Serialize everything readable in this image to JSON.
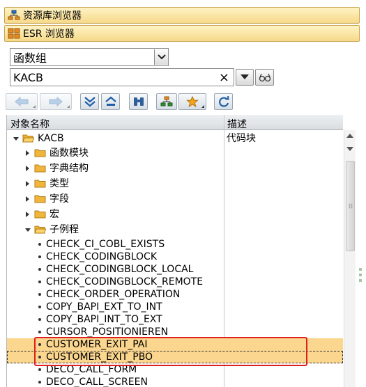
{
  "nav": {
    "repository_browser": "资源库浏览器",
    "esr_browser": "ESR 浏览器"
  },
  "object_type": {
    "selected": "函数组"
  },
  "object_name": {
    "value": "KACB",
    "clear_symbol": "×"
  },
  "tree": {
    "col_object_name": "对象名称",
    "col_description": "描述",
    "root": {
      "label": "KACB",
      "description": "代码块"
    },
    "folders": [
      {
        "label": "函数模块"
      },
      {
        "label": "字典结构"
      },
      {
        "label": "类型"
      },
      {
        "label": "字段"
      },
      {
        "label": "宏"
      },
      {
        "label": "子例程"
      }
    ],
    "subroutines": [
      "CHECK_CI_COBL_EXISTS",
      "CHECK_CODINGBLOCK",
      "CHECK_CODINGBLOCK_LOCAL",
      "CHECK_CODINGBLOCK_REMOTE",
      "CHECK_ORDER_OPERATION",
      "COPY_BAPI_EXT_TO_INT",
      "COPY_BAPI_INT_TO_EXT",
      "CURSOR_POSITIONIEREN",
      "CUSTOMER_EXIT_PAI",
      "CUSTOMER_EXIT_PBO",
      "DECO_CALL_FORM",
      "DECO_CALL_SCREEN"
    ]
  },
  "colors": {
    "highlight_row": "#fbd68f",
    "annotation_box": "#e0201c",
    "nav_button": "#f6d98a"
  }
}
